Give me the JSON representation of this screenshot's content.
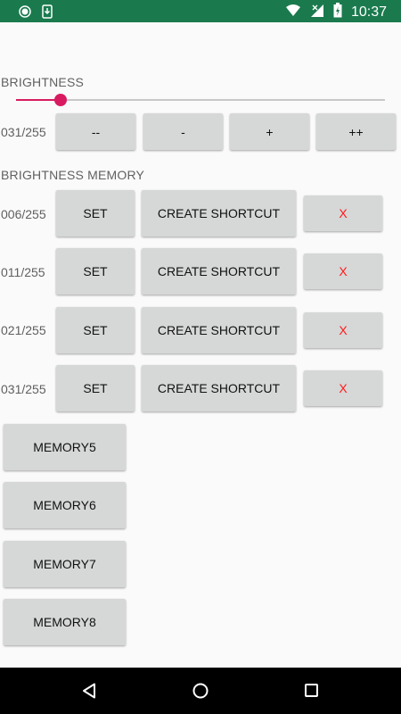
{
  "status_bar": {
    "time": "10:37",
    "color": "#1a7a4e",
    "icons": [
      "circle-icon",
      "download-icon",
      "wifi-icon",
      "signal-icon",
      "battery-icon"
    ]
  },
  "brightness": {
    "label": "BRIGHTNESS",
    "value_text": "031/255",
    "slider_value": 31,
    "slider_max": 255,
    "accent_color": "#d81b60",
    "buttons": [
      "--",
      "-",
      "+",
      "++"
    ]
  },
  "memory": {
    "label": "BRIGHTNESS MEMORY",
    "set_label": "SET",
    "shortcut_label": "CREATE SHORTCUT",
    "delete_label": "X",
    "delete_color": "#ff1a1a",
    "entries": [
      {
        "value_text": "006/255"
      },
      {
        "value_text": "011/255"
      },
      {
        "value_text": "021/255"
      },
      {
        "value_text": "031/255"
      }
    ],
    "extra_buttons": [
      "MEMORY5",
      "MEMORY6",
      "MEMORY7",
      "MEMORY8"
    ]
  },
  "nav_bar": {
    "icons": [
      "back-icon",
      "home-icon",
      "recents-icon"
    ]
  }
}
